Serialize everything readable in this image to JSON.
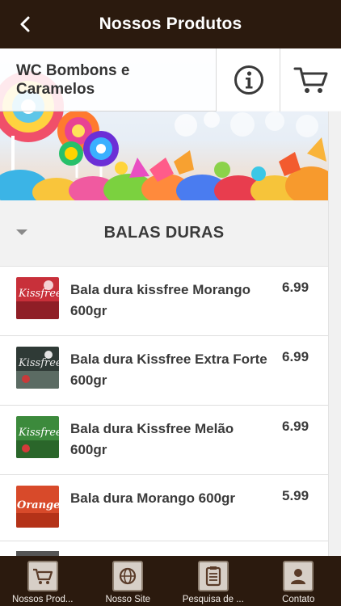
{
  "topbar": {
    "title": "Nossos Produtos"
  },
  "store": {
    "name": "WC Bombons e Caramelos"
  },
  "category": {
    "label": "BALAS DURAS"
  },
  "products": [
    {
      "name": "Bala dura kissfree Morango 600gr",
      "price": "6.99",
      "thumb_color": "#c8303a",
      "thumb_text": "Kissfree"
    },
    {
      "name": "Bala dura Kissfree Extra Forte 600gr",
      "price": "6.99",
      "thumb_color": "#2f3a36",
      "thumb_text": "Kissfree"
    },
    {
      "name": "Bala dura Kissfree Melão 600gr",
      "price": "6.99",
      "thumb_color": "#3c8a3c",
      "thumb_text": "Kissfree"
    },
    {
      "name": "Bala dura Morango 600gr",
      "price": "5.99",
      "thumb_color": "#d84a2a",
      "thumb_text": "Orange"
    }
  ],
  "tabs": [
    {
      "label": "Nossos Prod...",
      "icon": "cart-icon"
    },
    {
      "label": "Nosso Site",
      "icon": "globe-icon"
    },
    {
      "label": "Pesquisa de ...",
      "icon": "clipboard-icon"
    },
    {
      "label": "Contato",
      "icon": "contact-icon"
    }
  ],
  "colors": {
    "topbar": "#2b1a0e",
    "tabbar": "#2b1a0e"
  }
}
